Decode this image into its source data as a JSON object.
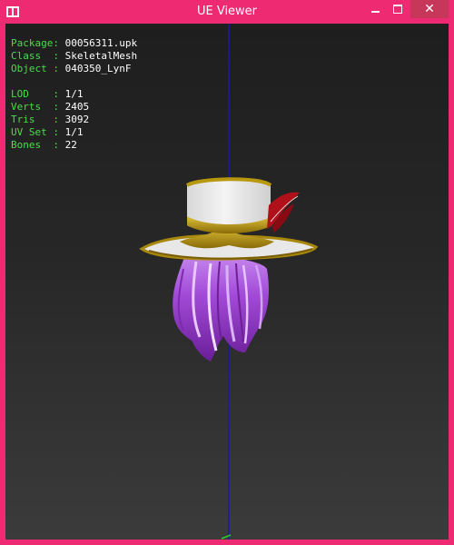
{
  "window": {
    "title": "UE Viewer"
  },
  "info": {
    "package_label": "Package:",
    "package_value": "00056311.upk",
    "class_label": "Class  :",
    "class_value": "SkeletalMesh",
    "object_label": "Object :",
    "object_value": "040350_LynF",
    "lod_label": "LOD    :",
    "lod_value": "1/1",
    "verts_label": "Verts  :",
    "verts_value": "2405",
    "tris_label": "Tris   :",
    "tris_value": "3092",
    "uvset_label": "UV Set :",
    "uvset_value": "1/1",
    "bones_label": "Bones  :",
    "bones_value": "22"
  },
  "colors": {
    "titlebar": "#ee2a72",
    "close_button": "#c7375a",
    "label_text": "#4cdc4c",
    "value_text": "#ffffff",
    "axis_line": "#1a1aa8",
    "hat_gold": "#b8980e",
    "hat_white": "#eeeeee",
    "hair_purple": "#a24ad8",
    "feather_red": "#b0101a"
  }
}
